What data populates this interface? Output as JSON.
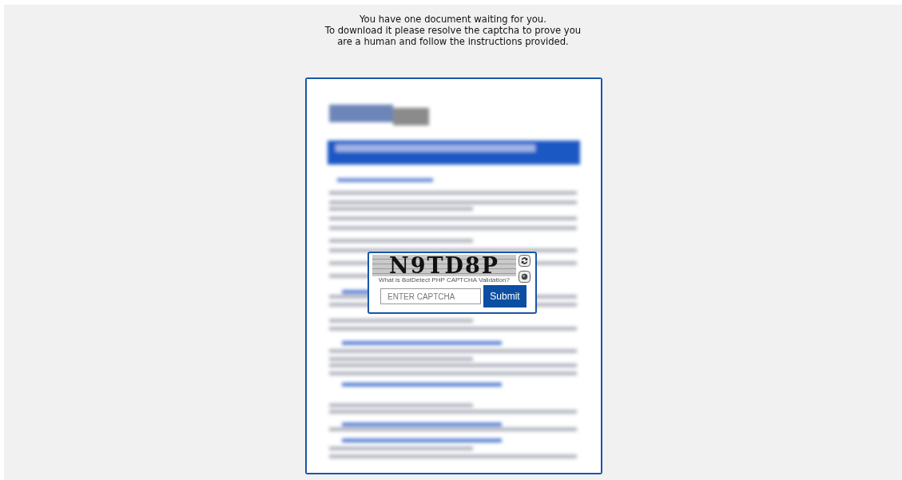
{
  "message": [
    "You have one document waiting for you.",
    "To download it please resolve the captcha to prove you",
    "are a human and follow the instructions provided."
  ],
  "captcha": {
    "code": "N9TD8P",
    "help_link": "What is BotDetect PHP CAPTCHA Validation?",
    "field": {
      "placeholder": "ENTER CAPTCHA"
    },
    "submit": "Submit"
  }
}
